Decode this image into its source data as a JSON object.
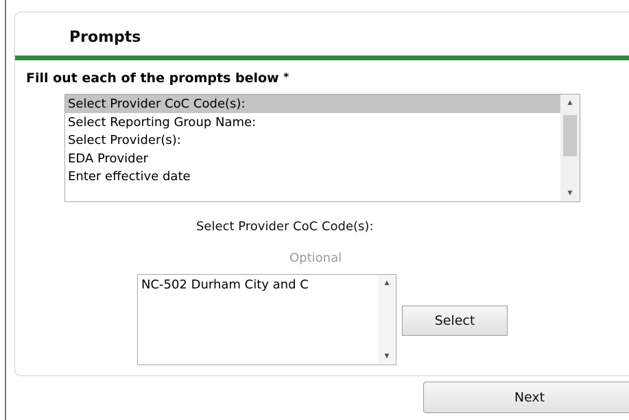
{
  "panel": {
    "title": "Prompts",
    "instructions": "Fill out each of the prompts below",
    "required_marker": "*",
    "accent_color": "#2e8b3a"
  },
  "prompt_list": {
    "items": [
      {
        "label": "Select Provider CoC Code(s):",
        "selected": true
      },
      {
        "label": "Select Reporting Group Name:",
        "selected": false
      },
      {
        "label": "Select Provider(s):",
        "selected": false
      },
      {
        "label": "EDA Provider",
        "selected": false
      },
      {
        "label": "Enter effective date",
        "selected": false
      }
    ],
    "scroll_up_icon": "triangle-up-icon",
    "scroll_down_icon": "triangle-down-icon"
  },
  "current_prompt": {
    "label": "Select Provider CoC Code(s):",
    "optional_text": "Optional",
    "options": [
      {
        "label": "NC-502 Durham City and C"
      }
    ],
    "select_label": "Select"
  },
  "footer": {
    "next_label": "Next"
  }
}
